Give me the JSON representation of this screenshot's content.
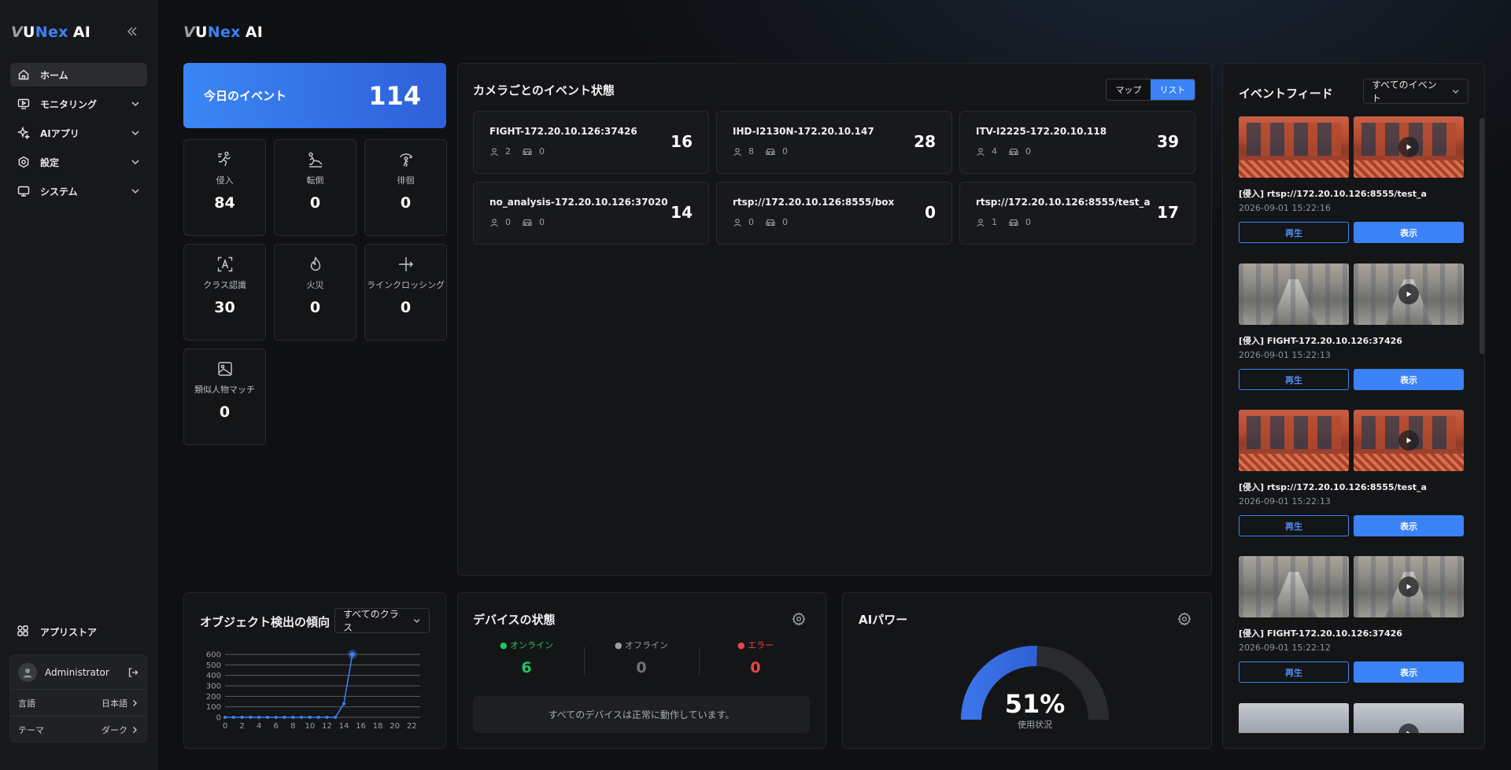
{
  "app": {
    "logo_v": "V",
    "logo_u": "U",
    "logo_nex": "Nex",
    "logo_ai": "AI"
  },
  "sidebar": {
    "items": [
      {
        "label": "ホーム",
        "icon": "home-icon"
      },
      {
        "label": "モニタリング",
        "icon": "monitor-play-icon"
      },
      {
        "label": "AIアプリ",
        "icon": "sparkle-icon"
      },
      {
        "label": "設定",
        "icon": "settings-hex-icon"
      },
      {
        "label": "システム",
        "icon": "desktop-icon"
      }
    ],
    "appstore": "アプリストア",
    "user": "Administrator",
    "language_label": "言語",
    "language_value": "日本語",
    "theme_label": "テーマ",
    "theme_value": "ダーク"
  },
  "today": {
    "label": "今日のイベント",
    "value": "114"
  },
  "stats": [
    {
      "label": "侵入",
      "value": "84",
      "icon": "intrusion-icon"
    },
    {
      "label": "転倒",
      "value": "0",
      "icon": "fall-icon"
    },
    {
      "label": "徘徊",
      "value": "0",
      "icon": "loitering-icon"
    },
    {
      "label": "クラス認識",
      "value": "30",
      "icon": "class-recognition-icon"
    },
    {
      "label": "火災",
      "value": "0",
      "icon": "fire-icon"
    },
    {
      "label": "ラインクロッシング",
      "value": "0",
      "icon": "line-crossing-icon"
    },
    {
      "label": "類似人物マッチ",
      "value": "0",
      "icon": "image-icon"
    }
  ],
  "camera_panel": {
    "title": "カメラごとのイベント状態",
    "toggle_map": "マップ",
    "toggle_list": "リスト",
    "cameras": [
      {
        "name": "FIGHT-172.20.10.126:37426",
        "persons": "2",
        "vehicles": "0",
        "count": "16"
      },
      {
        "name": "IHD-I2130N-172.20.10.147",
        "persons": "8",
        "vehicles": "0",
        "count": "28"
      },
      {
        "name": "ITV-I2225-172.20.10.118",
        "persons": "4",
        "vehicles": "0",
        "count": "39"
      },
      {
        "name": "no_analysis-172.20.10.126:37020",
        "persons": "0",
        "vehicles": "0",
        "count": "14"
      },
      {
        "name": "rtsp://172.20.10.126:8555/box",
        "persons": "0",
        "vehicles": "0",
        "count": "0"
      },
      {
        "name": "rtsp://172.20.10.126:8555/test_a",
        "persons": "1",
        "vehicles": "0",
        "count": "17"
      }
    ]
  },
  "trend": {
    "title": "オブジェクト検出の傾向",
    "filter": "すべてのクラス"
  },
  "chart_data": {
    "type": "line",
    "title": "",
    "xlabel": "",
    "ylabel": "",
    "x": [
      0,
      1,
      2,
      3,
      4,
      5,
      6,
      7,
      8,
      9,
      10,
      11,
      12,
      13,
      14,
      15
    ],
    "values": [
      0,
      0,
      0,
      0,
      0,
      0,
      0,
      0,
      0,
      0,
      0,
      0,
      0,
      0,
      130,
      600
    ],
    "x_ticks": [
      0,
      2,
      4,
      6,
      8,
      10,
      12,
      14,
      16,
      18,
      20,
      22
    ],
    "y_ticks": [
      0,
      100,
      200,
      300,
      400,
      500,
      600
    ],
    "ylim": [
      0,
      600
    ],
    "xlim": [
      0,
      23
    ],
    "grid": true,
    "color": "#3b82f6"
  },
  "device": {
    "title": "デバイスの状態",
    "online_label": "オンライン",
    "online_value": "6",
    "offline_label": "オフライン",
    "offline_value": "0",
    "error_label": "エラー",
    "error_value": "0",
    "message": "すべてのデバイスは正常に動作しています。"
  },
  "ai_power": {
    "title": "AIパワー",
    "percent": 51,
    "value_text": "51%",
    "label": "使用状況"
  },
  "feed": {
    "title": "イベントフィード",
    "filter": "すべてのイベント",
    "play_label": "再生",
    "view_label": "表示",
    "items": [
      {
        "title": "[侵入] rtsp://172.20.10.126:8555/test_a",
        "time": "2026-09-01 15:22:16",
        "scene": "red"
      },
      {
        "title": "[侵入] FIGHT-172.20.10.126:37426",
        "time": "2026-09-01 15:22:13",
        "scene": "street"
      },
      {
        "title": "[侵入] rtsp://172.20.10.126:8555/test_a",
        "time": "2026-09-01 15:22:13",
        "scene": "red"
      },
      {
        "title": "[侵入] FIGHT-172.20.10.126:37426",
        "time": "2026-09-01 15:22:12",
        "scene": "street"
      }
    ]
  },
  "colors": {
    "accent": "#3b82f6",
    "online": "#22c55e",
    "offline": "#9a9da3",
    "error": "#ef4444"
  }
}
